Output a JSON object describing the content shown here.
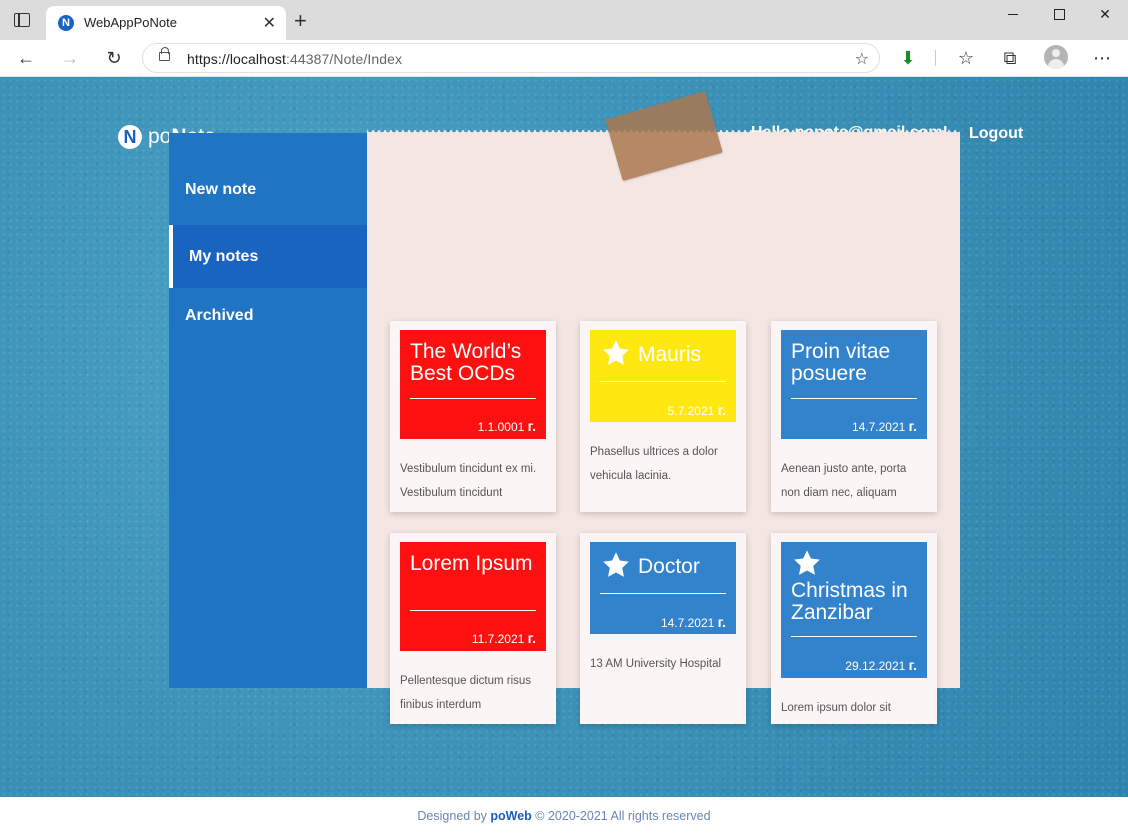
{
  "browser": {
    "tab_title": "WebAppPoNote",
    "url_host": "https://localhost",
    "url_rest": ":44387/Note/Index"
  },
  "header": {
    "brand_prefix": "po",
    "brand_strong": "N",
    "brand_suffix": "ote",
    "logo_letter": "N",
    "hello": "Hello ponote@gmail.com!",
    "logout": "Logout"
  },
  "sidebar": {
    "items": [
      {
        "label": "New note"
      },
      {
        "label": "My notes"
      },
      {
        "label": "Archived"
      }
    ]
  },
  "notes": [
    {
      "title": "The World’s Best OCDs",
      "date": "1.1.0001",
      "suffix": "г.",
      "body": "Vestibulum tincidunt ex mi. Vestibulum tincidunt",
      "color": "#ff0f0f",
      "starred": false
    },
    {
      "title": "Mauris",
      "date": "5.7.2021",
      "suffix": "г.",
      "body": "Phasellus ultrices a dolor vehicula lacinia.",
      "color": "#ffe812",
      "starred": true
    },
    {
      "title": "Proin vitae posuere",
      "date": "14.7.2021",
      "suffix": "г.",
      "body": "Aenean justo ante, porta non diam nec, aliquam",
      "color": "#3282cc",
      "starred": false
    },
    {
      "title": "Lorem Ipsum",
      "date": "11.7.2021",
      "suffix": "г.",
      "body": "Pellentesque dictum risus finibus interdum",
      "color": "#ff0f0f",
      "starred": false
    },
    {
      "title": "Doctor",
      "date": "14.7.2021",
      "suffix": "г.",
      "body": "13 AM University Hospital",
      "color": "#3282cc",
      "starred": true
    },
    {
      "title": "Christmas in Zanzibar",
      "date": "29.12.2021",
      "suffix": "г.",
      "body": "Lorem ipsum dolor sit",
      "color": "#3282cc",
      "starred": true
    }
  ],
  "footer": {
    "prefix": "Designed by ",
    "brand": "poWeb",
    "suffix": " © 2020-2021 All rights reserved"
  }
}
